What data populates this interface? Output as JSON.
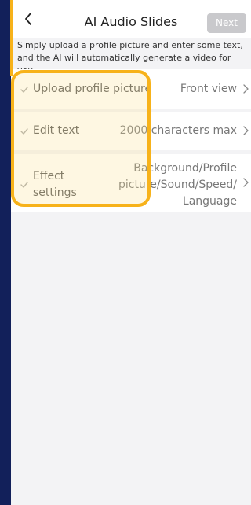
{
  "header": {
    "title": "AI Audio Slides",
    "next_label": "Next"
  },
  "description": "Simply upload a profile picture and enter some text, and the AI will automatically generate a video for you.",
  "rows": [
    {
      "label": "Upload profile picture",
      "value": "Front view"
    },
    {
      "label": "Edit text",
      "value": "2000 characters max"
    },
    {
      "label_line1": "Effect",
      "label_line2": "settings",
      "value_line1": "Background/Profile",
      "value_line2": "picture/Sound/Speed/",
      "value_line3": "Language"
    }
  ],
  "colors": {
    "accent": "#f7b21a",
    "check": "#a8a8a8",
    "page_bg": "#f3f3f5",
    "frame": "#12205a"
  }
}
